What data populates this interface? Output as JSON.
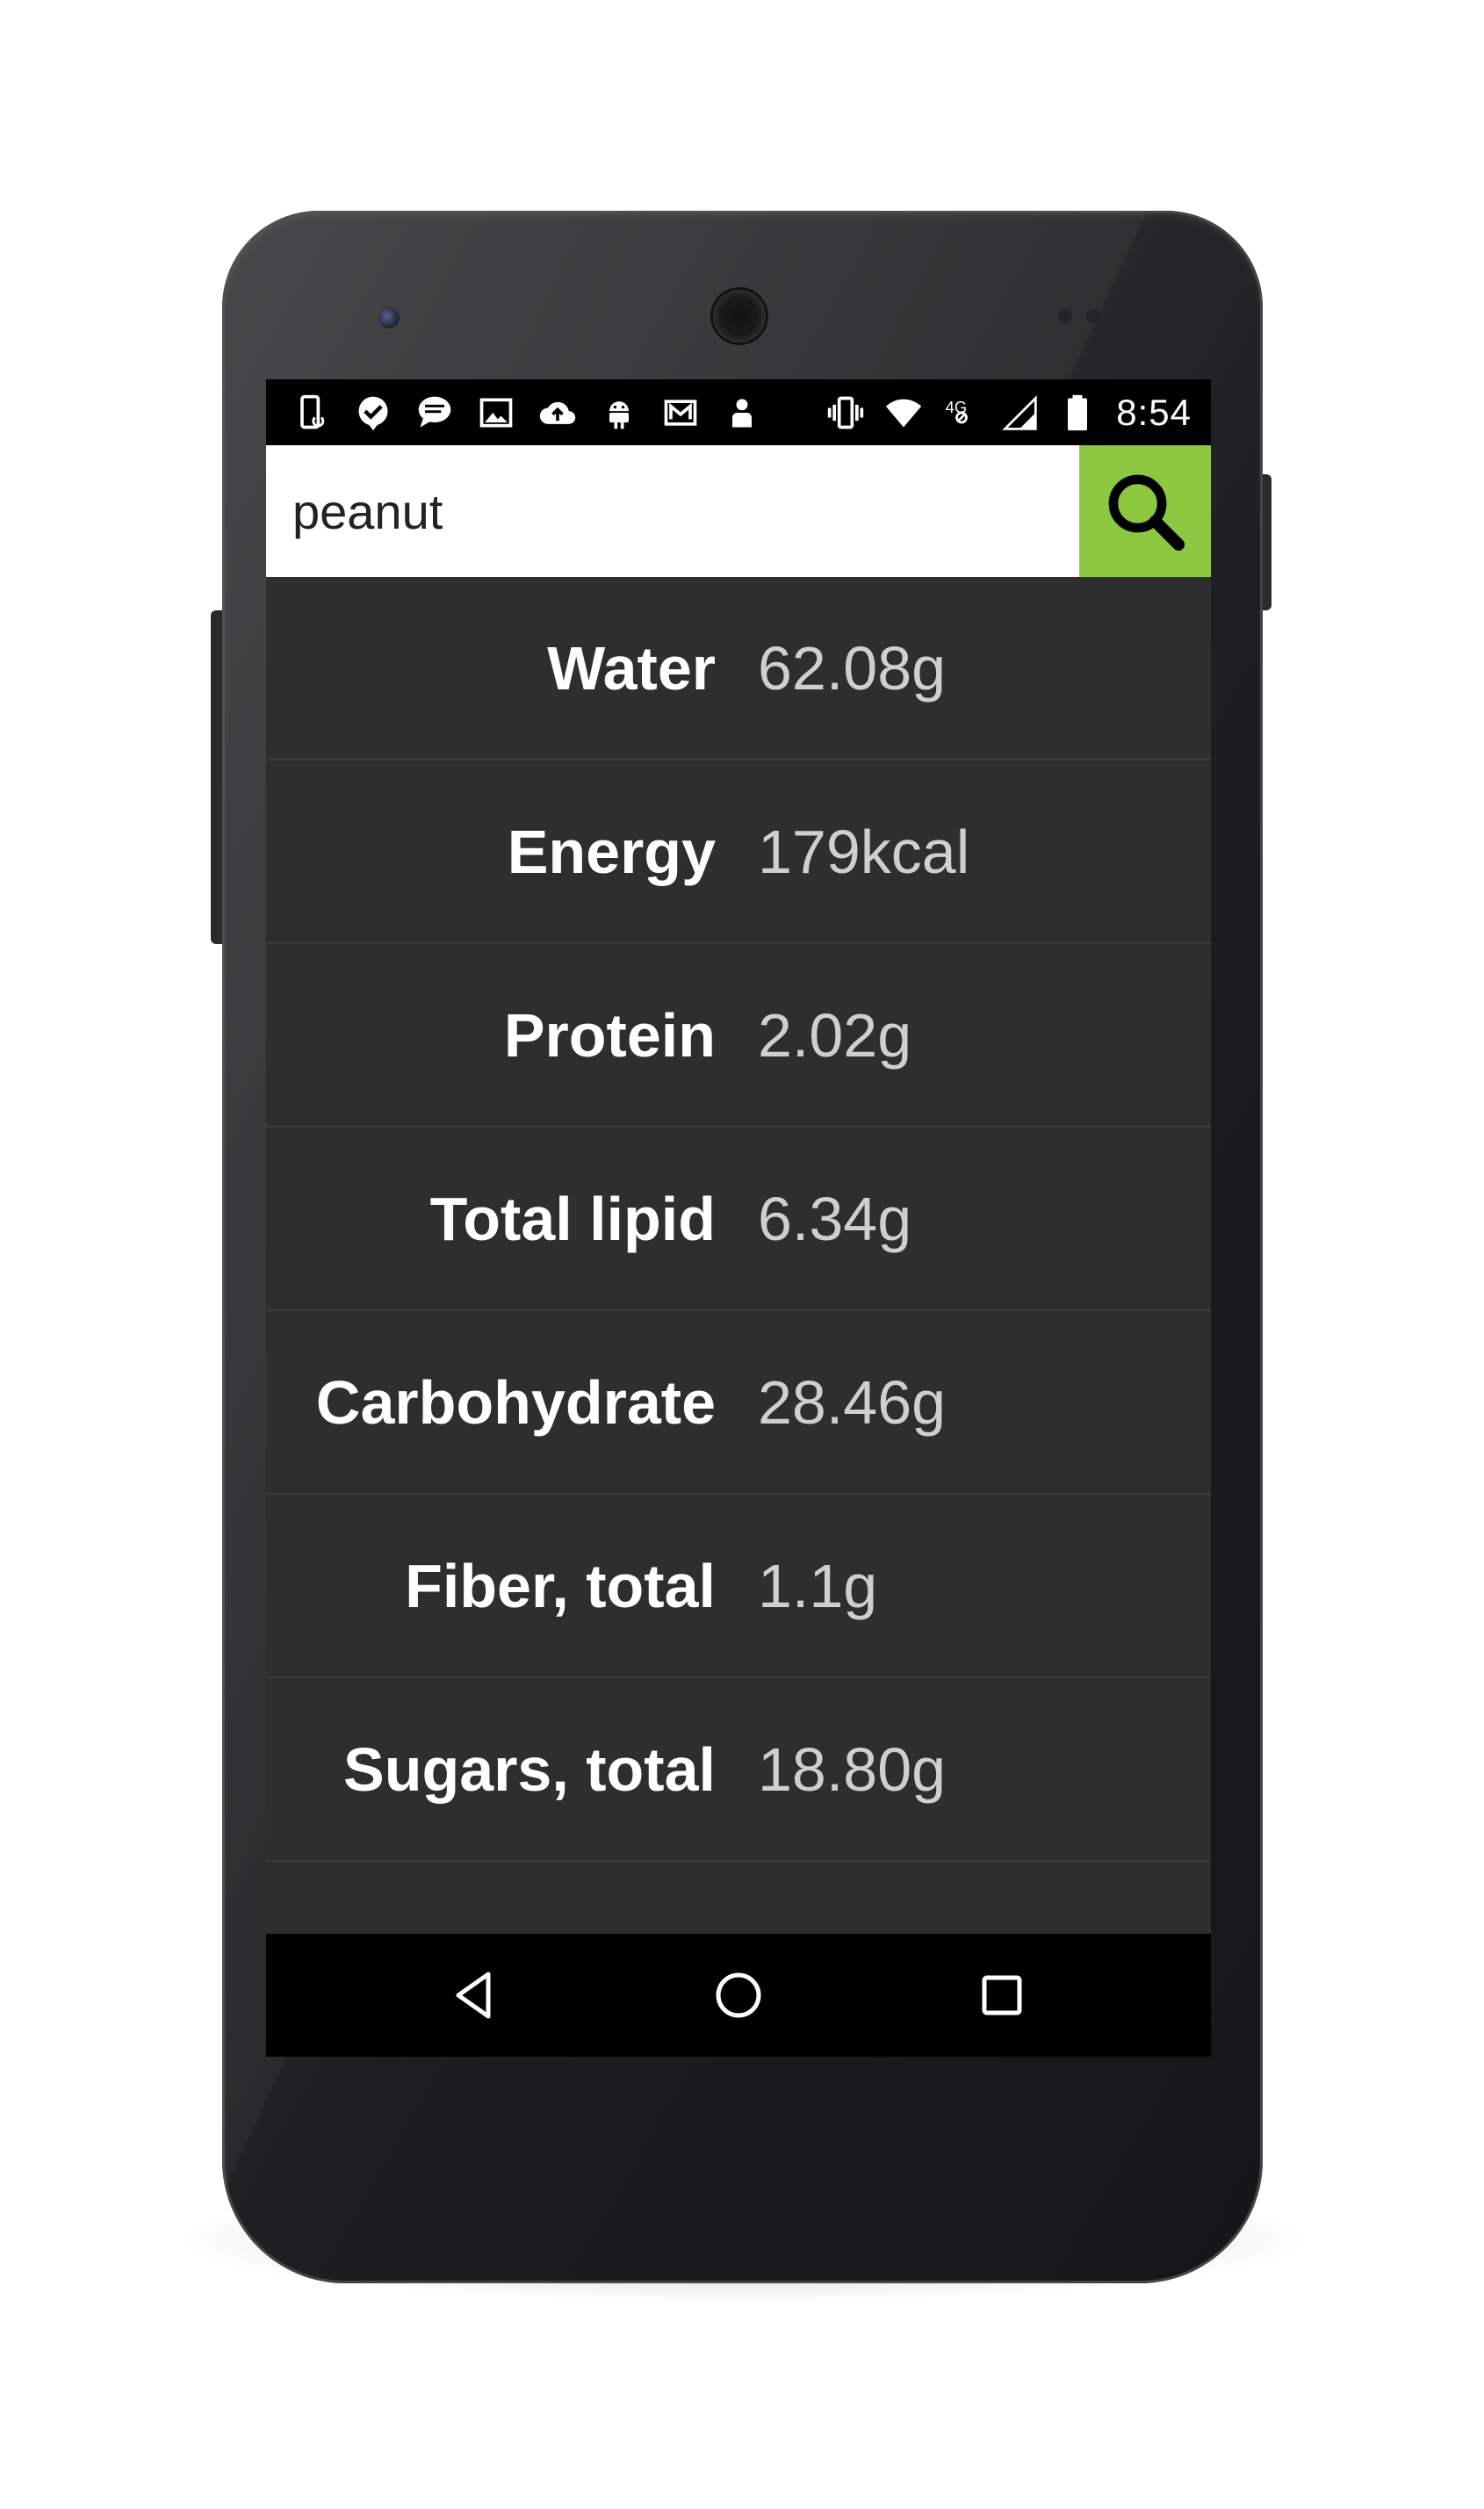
{
  "status_bar": {
    "time": "8:54",
    "left_icons": [
      "phone-sync-icon",
      "check-badge-icon",
      "chat-bubble-icon",
      "image-icon",
      "cloud-upload-icon",
      "android-icon",
      "mail-icon",
      "person-icon"
    ],
    "right_icons": [
      "vibrate-icon",
      "wifi-icon",
      "network-4g-icon",
      "cell-signal-icon",
      "battery-icon"
    ]
  },
  "search": {
    "value": "peanut",
    "button_icon": "search-icon",
    "button_color": "#8dc63f"
  },
  "nutrients": [
    {
      "label": "Water",
      "value": "62.08g"
    },
    {
      "label": "Energy",
      "value": "179kcal"
    },
    {
      "label": "Protein",
      "value": "2.02g"
    },
    {
      "label": "Total lipid",
      "value": "6.34g"
    },
    {
      "label": "Carbohydrate",
      "value": "28.46g"
    },
    {
      "label": "Fiber, total",
      "value": "1.1g"
    },
    {
      "label": "Sugars, total",
      "value": "18.80g"
    }
  ],
  "nav_bar": {
    "buttons": [
      "back-icon",
      "home-icon",
      "recents-icon"
    ]
  }
}
